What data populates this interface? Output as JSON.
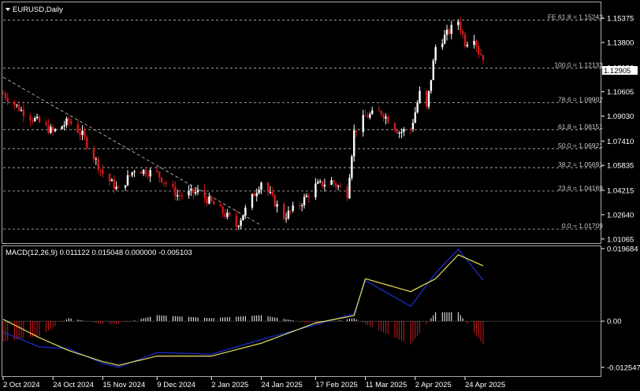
{
  "chart": {
    "symbol_title": "EURUSD,Daily",
    "current_price": "1.12905",
    "colors": {
      "background": "#000000",
      "bull": "#ffffff",
      "bear": "#d11a1a",
      "grid": "#ffffff",
      "macd_line": "#1c2fd8",
      "signal_line": "#e8e15a",
      "hist_pos": "#ffffff",
      "hist_neg": "#d11a1a"
    }
  },
  "chart_data": [
    {
      "type": "candlestick",
      "title": "EURUSD,Daily",
      "y_ticks": [
        "1.15375",
        "1.13800",
        "1.12180",
        "1.10605",
        "1.09030",
        "1.07410",
        "1.05835",
        "1.04215",
        "1.02640",
        "1.01065"
      ],
      "x_ticks": [
        "2 Oct 2024",
        "24 Oct 2024",
        "15 Nov 2024",
        "9 Dec 2024",
        "2 Jan 2025",
        "24 Jan 2025",
        "17 Feb 2025",
        "11 Mar 2025",
        "2 Apr 2025",
        "24 Apr 2025"
      ],
      "ylim": [
        1.0085,
        1.1635
      ],
      "fibonacci_levels": [
        {
          "label": "FE 61.8 = 1.15243",
          "value": 1.15243
        },
        {
          "label": "100.0 = 1.12133",
          "value": 1.12133
        },
        {
          "label": "78.6 = 1.09902",
          "value": 1.09902
        },
        {
          "label": "61.8 = 1.08151",
          "value": 1.08151
        },
        {
          "label": "50.0 = 1.06921",
          "value": 1.06921
        },
        {
          "label": "38.2 = 1.05691",
          "value": 1.05691
        },
        {
          "label": "23.6 = 1.04169",
          "value": 1.04169
        },
        {
          "label": "0.0 = 1.01709",
          "value": 1.01709
        }
      ],
      "trendline": {
        "from": [
          "2 Oct 2024",
          1.1155
        ],
        "to": [
          "24 Jan 2025",
          1.0195
        ]
      },
      "close_path": [
        [
          "2 Oct 2024",
          1.105
        ],
        [
          "10 Oct 2024",
          1.094
        ],
        [
          "18 Oct 2024",
          1.086
        ],
        [
          "24 Oct 2024",
          1.08
        ],
        [
          "31 Oct 2024",
          1.087
        ],
        [
          "6 Nov 2024",
          1.078
        ],
        [
          "15 Nov 2024",
          1.053
        ],
        [
          "22 Nov 2024",
          1.042
        ],
        [
          "29 Nov 2024",
          1.056
        ],
        [
          "9 Dec 2024",
          1.053
        ],
        [
          "18 Dec 2024",
          1.039
        ],
        [
          "27 Dec 2024",
          1.041
        ],
        [
          "2 Jan 2025",
          1.034
        ],
        [
          "10 Jan 2025",
          1.024
        ],
        [
          "13 Jan 2025",
          1.019
        ],
        [
          "24 Jan 2025",
          1.048
        ],
        [
          "3 Feb 2025",
          1.025
        ],
        [
          "10 Feb 2025",
          1.033
        ],
        [
          "17 Feb 2025",
          1.045
        ],
        [
          "24 Feb 2025",
          1.048
        ],
        [
          "3 Mar 2025",
          1.04
        ],
        [
          "6 Mar 2025",
          1.08
        ],
        [
          "11 Mar 2025",
          1.09
        ],
        [
          "18 Mar 2025",
          1.093
        ],
        [
          "26 Mar 2025",
          1.08
        ],
        [
          "31 Mar 2025",
          1.082
        ],
        [
          "2 Apr 2025",
          1.093
        ],
        [
          "4 Apr 2025",
          1.105
        ],
        [
          "7 Apr 2025",
          1.095
        ],
        [
          "11 Apr 2025",
          1.135
        ],
        [
          "21 Apr 2025",
          1.152
        ],
        [
          "24 Apr 2025",
          1.138
        ],
        [
          "28 Apr 2025",
          1.142
        ],
        [
          "30 Apr 2025",
          1.132
        ],
        [
          "2 May 2025",
          1.129
        ]
      ]
    },
    {
      "type": "macd",
      "title": "MACD(12,26,9) 0.011122 0.015048 0.000000 -0.005103",
      "y_ticks": [
        "0.019684",
        "0.00",
        "-0.012547"
      ],
      "ylim": [
        -0.0147,
        0.0201
      ],
      "series": [
        {
          "name": "MACD",
          "values_by_date": [
            [
              "2 Oct 2024",
              -0.003
            ],
            [
              "18 Oct 2024",
              -0.007
            ],
            [
              "31 Oct 2024",
              -0.0075
            ],
            [
              "15 Nov 2024",
              -0.0115
            ],
            [
              "22 Nov 2024",
              -0.0125
            ],
            [
              "9 Dec 2024",
              -0.0085
            ],
            [
              "2 Jan 2025",
              -0.009
            ],
            [
              "24 Jan 2025",
              -0.005
            ],
            [
              "17 Feb 2025",
              -0.001
            ],
            [
              "6 Mar 2025",
              0.002
            ],
            [
              "11 Mar 2025",
              0.011
            ],
            [
              "31 Mar 2025",
              0.004
            ],
            [
              "11 Apr 2025",
              0.013
            ],
            [
              "21 Apr 2025",
              0.0195
            ],
            [
              "2 May 2025",
              0.0111
            ]
          ]
        },
        {
          "name": "Signal",
          "values_by_date": [
            [
              "2 Oct 2024",
              0.0005
            ],
            [
              "18 Oct 2024",
              -0.0045
            ],
            [
              "31 Oct 2024",
              -0.008
            ],
            [
              "15 Nov 2024",
              -0.011
            ],
            [
              "22 Nov 2024",
              -0.012
            ],
            [
              "9 Dec 2024",
              -0.0095
            ],
            [
              "2 Jan 2025",
              -0.0095
            ],
            [
              "24 Jan 2025",
              -0.006
            ],
            [
              "17 Feb 2025",
              -0.0005
            ],
            [
              "6 Mar 2025",
              0.0015
            ],
            [
              "11 Mar 2025",
              0.0115
            ],
            [
              "31 Mar 2025",
              0.008
            ],
            [
              "11 Apr 2025",
              0.0115
            ],
            [
              "21 Apr 2025",
              0.018
            ],
            [
              "2 May 2025",
              0.015
            ]
          ]
        }
      ]
    }
  ]
}
